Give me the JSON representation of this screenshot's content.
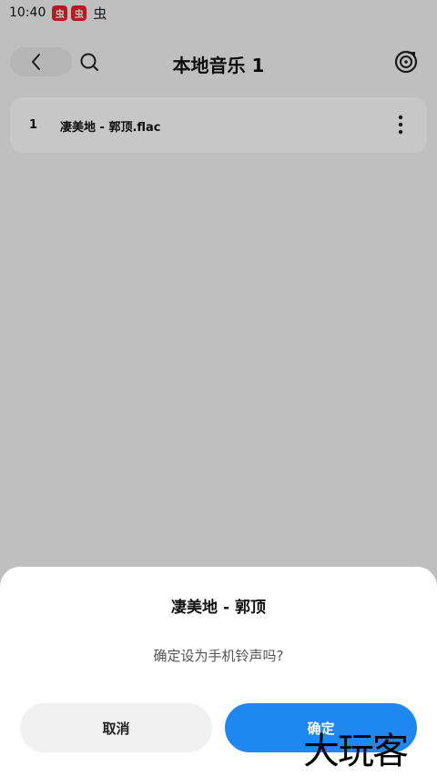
{
  "status_bar": {
    "time": "10:40",
    "badges": [
      "虫",
      "虫"
    ],
    "extra_glyph": "虫",
    "badge_color": "#e3262b"
  },
  "header": {
    "title": "本地音乐 1",
    "back_icon": "chevron-left-icon",
    "search_icon": "search-icon",
    "disc_icon": "disc-icon"
  },
  "songs": [
    {
      "index": "1",
      "title": "凄美地 - 郭顶.flac"
    }
  ],
  "dialog": {
    "title": "凄美地 - 郭顶",
    "message": "确定设为手机铃声吗?",
    "cancel_label": "取消",
    "confirm_label": "确定",
    "confirm_color": "#1e87f0"
  },
  "watermark": "大玩客"
}
